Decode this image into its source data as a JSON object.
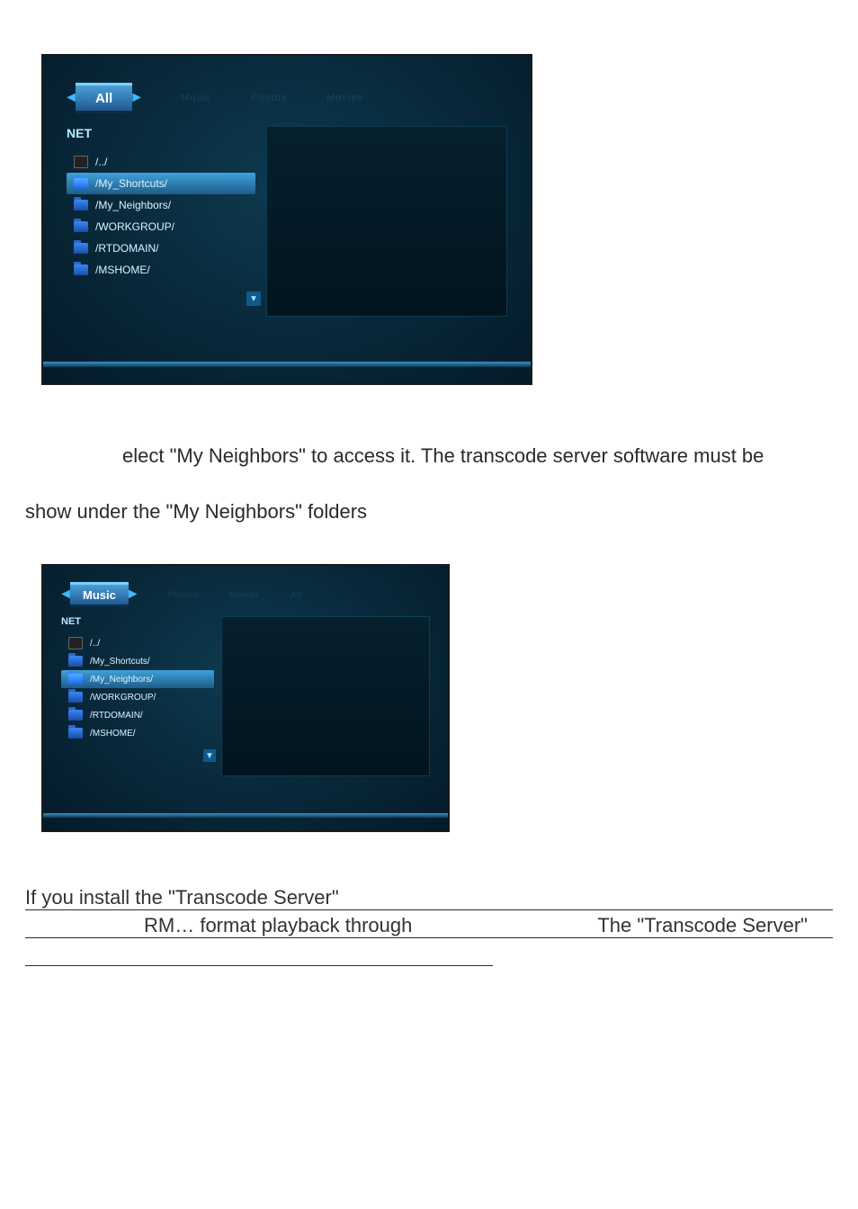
{
  "body_text": {
    "line1_right": "elect \"My Neighbors\" to access it.   The transcode server software must be",
    "line2": "show under the \"My Neighbors\" folders",
    "bottom1_prefix": " If you install the \"Transcode Server\"",
    "bottom2_left": "RM… format playback through",
    "bottom2_right": "The \"Transcode Server\""
  },
  "shot1": {
    "tabs": {
      "active": "All",
      "t1": "Music",
      "t2": "Photos",
      "t3": "Movies"
    },
    "panel_title": "NET",
    "items": [
      {
        "type": "pc",
        "label": "/../",
        "selected": false
      },
      {
        "type": "fld",
        "label": "/My_Shortcuts/",
        "selected": true
      },
      {
        "type": "fld",
        "label": "/My_Neighbors/",
        "selected": false
      },
      {
        "type": "fld",
        "label": "/WORKGROUP/",
        "selected": false
      },
      {
        "type": "fld",
        "label": "/RTDOMAIN/",
        "selected": false
      },
      {
        "type": "fld",
        "label": "/MSHOME/",
        "selected": false
      }
    ],
    "scroll_glyph": "▼"
  },
  "shot2": {
    "tabs": {
      "active": "Music",
      "t1": "Photos",
      "t2": "Movies",
      "t3": "All"
    },
    "panel_title": "NET",
    "items": [
      {
        "type": "pc",
        "label": "/../",
        "selected": false
      },
      {
        "type": "fld",
        "label": "/My_Shortcuts/",
        "selected": false
      },
      {
        "type": "fld",
        "label": "/My_Neighbors/",
        "selected": true
      },
      {
        "type": "fld",
        "label": "/WORKGROUP/",
        "selected": false
      },
      {
        "type": "fld",
        "label": "/RTDOMAIN/",
        "selected": false
      },
      {
        "type": "fld",
        "label": "/MSHOME/",
        "selected": false
      }
    ],
    "scroll_glyph": "▼"
  }
}
